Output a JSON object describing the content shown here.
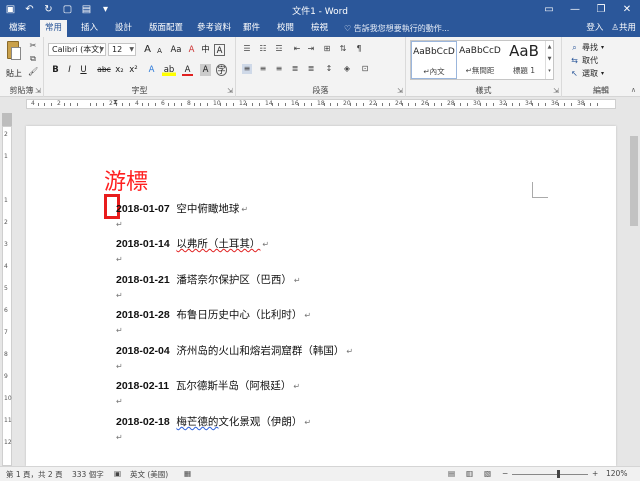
{
  "window": {
    "title": "文件1 - Word",
    "min_icon": "minimize-icon",
    "max_icon": "restore-icon",
    "close_icon": "close-icon"
  },
  "qat": [
    "save-icon",
    "undo-icon",
    "redo-icon",
    "new-icon",
    "open-icon",
    "customize-icon"
  ],
  "tabs": [
    {
      "label": "檔案"
    },
    {
      "label": "常用"
    },
    {
      "label": "插入"
    },
    {
      "label": "設計"
    },
    {
      "label": "版面配置"
    },
    {
      "label": "參考資料"
    },
    {
      "label": "郵件"
    },
    {
      "label": "校閱"
    },
    {
      "label": "檢視"
    }
  ],
  "tell_me": "告訴我您想要執行的動作...",
  "account": {
    "signin": "登入",
    "share": "共用"
  },
  "ribbon": {
    "clipboard": {
      "label": "剪貼簿",
      "paste": "貼上"
    },
    "font": {
      "label": "字型",
      "font_name": "Calibri (本文)",
      "font_size": "12",
      "grow": "A",
      "shrink": "A",
      "case": "Aa",
      "clear": "A",
      "phonetic": "中",
      "border": "A",
      "bold": "B",
      "italic": "I",
      "underline": "U",
      "strike": "abc",
      "sub": "x₂",
      "sup": "x²",
      "effects": "A",
      "highlight": "ab",
      "color": "A",
      "shade": "A",
      "circle": "字"
    },
    "paragraph": {
      "label": "段落"
    },
    "styles": {
      "label": "樣式",
      "items": [
        {
          "sample": "AaBbCcD",
          "name": "↵內文"
        },
        {
          "sample": "AaBbCcD",
          "name": "↵無間距"
        },
        {
          "sample": "AaB",
          "name": "標題 1"
        }
      ]
    },
    "editing": {
      "label": "編輯",
      "find": "尋找",
      "replace": "取代",
      "select": "選取"
    }
  },
  "ruler_numbers": [
    "4",
    "2",
    "",
    "2",
    "4",
    "6",
    "8",
    "10",
    "12",
    "14",
    "16",
    "18",
    "20",
    "22",
    "24",
    "26",
    "28",
    "30",
    "32",
    "34",
    "36",
    "38"
  ],
  "vruler_numbers": [
    "2",
    "1",
    "",
    "1",
    "2",
    "3",
    "4",
    "5",
    "6",
    "7",
    "8",
    "9",
    "10",
    "11",
    "12",
    "13"
  ],
  "annotation": {
    "text": "游標"
  },
  "document": {
    "lines": [
      {
        "date": "2018-01-07",
        "text": "空中俯瞰地球",
        "mark": "↵"
      },
      {
        "date": "2018-01-14",
        "text": "以弗所（土耳其）",
        "mark": "↵"
      },
      {
        "date": "2018-01-21",
        "text": "潘塔奈尔保护区（巴西）",
        "mark": "↵"
      },
      {
        "date": "2018-01-28",
        "text": "布鲁日历史中心（比利时）",
        "mark": "↵"
      },
      {
        "date": "2018-02-04",
        "text": "济州岛的火山和熔岩洞窟群（韩国）",
        "mark": "↵"
      },
      {
        "date": "2018-02-11",
        "text": "瓦尔德斯半岛（阿根廷）",
        "mark": "↵"
      },
      {
        "date": "2018-02-18",
        "text_a": "梅芒德的",
        "text_b": "文化景观（伊朗）",
        "mark": "↵"
      }
    ],
    "empty_mark": "↵"
  },
  "status": {
    "page": "第 1 頁，共 2 頁",
    "words": "333 個字",
    "lang": "英文 (美國)",
    "zoom": "120%",
    "zoom_minus": "−",
    "zoom_plus": "+",
    "zoom_fraction": 0.6
  },
  "colors": {
    "titlebar": "#2b579a",
    "annotation": "#ff2020"
  }
}
